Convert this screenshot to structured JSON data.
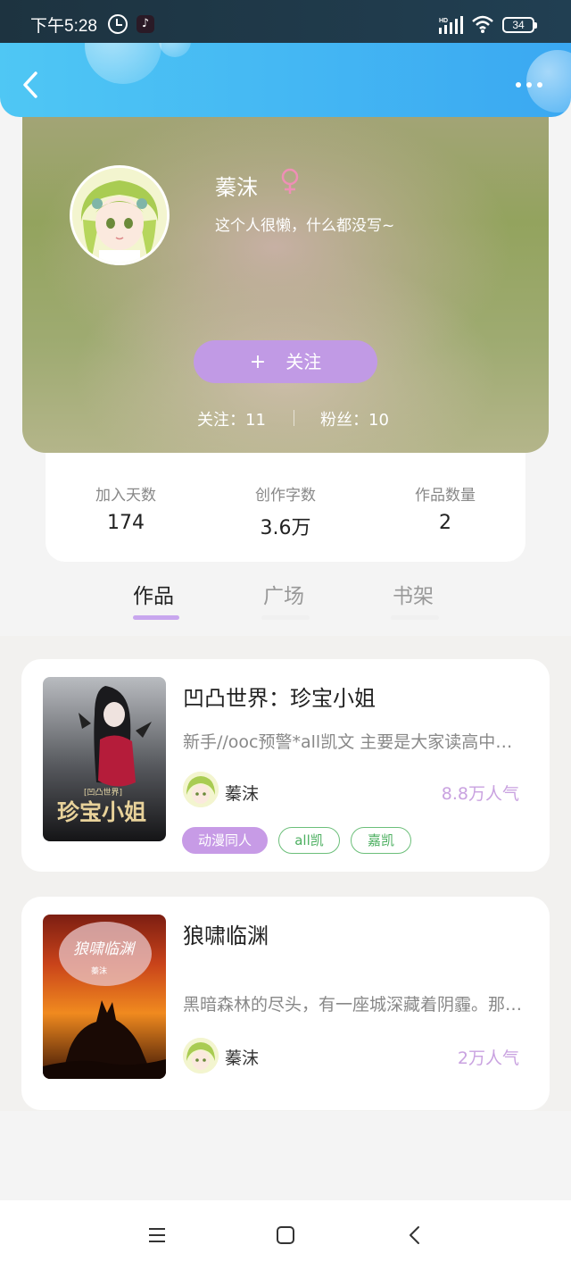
{
  "status_bar": {
    "time": "下午5:28",
    "battery": "34",
    "icons": [
      "alarm-icon",
      "tiktok-icon",
      "hd-signal-icon",
      "wifi-icon",
      "battery-icon"
    ]
  },
  "header": {
    "back_icon": "back-chevron-icon",
    "more_icon": "more-dots-icon"
  },
  "profile": {
    "username": "蓁沫",
    "gender_symbol": "♀",
    "bio": "这个人很懒，什么都没写~",
    "follow_button_icon": "+",
    "follow_button_label": "关注",
    "following": "关注：11",
    "fans": "粉丝：10"
  },
  "stats": [
    {
      "label": "加入天数",
      "value": "174"
    },
    {
      "label": "创作字数",
      "value": "3.6万"
    },
    {
      "label": "作品数量",
      "value": "2"
    }
  ],
  "tabs": [
    {
      "label": "作品",
      "active": true
    },
    {
      "label": "广场",
      "active": false
    },
    {
      "label": "书架",
      "active": false
    }
  ],
  "works": [
    {
      "title": "凹凸世界：珍宝小姐",
      "description": "新手//ooc预警*all凯文 主要是大家读高中时候的故事",
      "author": "蓁沫",
      "popularity": "8.8万人气",
      "tags": [
        "动漫同人",
        "all凯",
        "嘉凯"
      ],
      "cover_text": "珍宝小姐",
      "cover_subtext": "[凹凸世界]"
    },
    {
      "title": "狼啸临渊",
      "description": "黑暗森林的尽头，有一座城深藏着阴霾。那是一座被遗忘的城",
      "author": "蓁沫",
      "popularity": "2万人气",
      "tags": [],
      "cover_text": "狼啸临渊",
      "cover_subtext": "蓁沫"
    }
  ],
  "nav_bar": {
    "icons": [
      "menu-icon",
      "home-icon",
      "back-icon"
    ]
  },
  "colors": {
    "header_gradient": [
      "#4fc7f4",
      "#3aa8f2"
    ],
    "accent_purple": "#c19ae5",
    "tag_green": "#4caf60",
    "popularity_purple": "#c9a2e0"
  }
}
